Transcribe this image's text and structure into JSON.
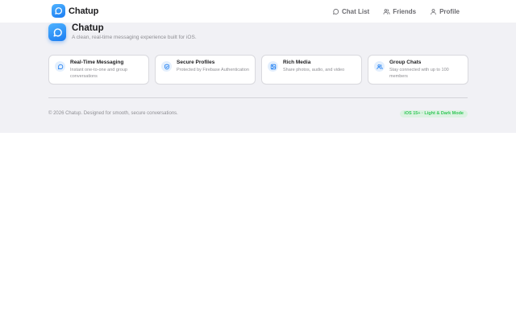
{
  "app": {
    "name": "Chatup",
    "tagline": "A clean, real-time messaging experience built for iOS."
  },
  "nav": [
    {
      "label": "Chat List",
      "icon": "chat-bubble-icon"
    },
    {
      "label": "Friends",
      "icon": "users-icon"
    },
    {
      "label": "Profile",
      "icon": "user-icon"
    }
  ],
  "features": [
    {
      "title": "Real-Time Messaging",
      "desc": "Instant one-to-one and group conversations",
      "icon": "chat-bubble-icon"
    },
    {
      "title": "Secure Profiles",
      "desc": "Protected by Firebase Authentication",
      "icon": "shield-check-icon"
    },
    {
      "title": "Rich Media",
      "desc": "Share photos, audio, and video",
      "icon": "image-icon"
    },
    {
      "title": "Group Chats",
      "desc": "Stay connected with up to 100 members",
      "icon": "users-icon"
    }
  ],
  "footer": {
    "copyright": "© 2026 Chatup. Designed for smooth, secure conversations.",
    "badge": "iOS 15+ · Light & Dark Mode"
  },
  "colors": {
    "accent": "#1a7cf2",
    "hero_background": "#f1f1f5",
    "badge_text": "#34c759",
    "badge_background": "#dcf2e2"
  }
}
